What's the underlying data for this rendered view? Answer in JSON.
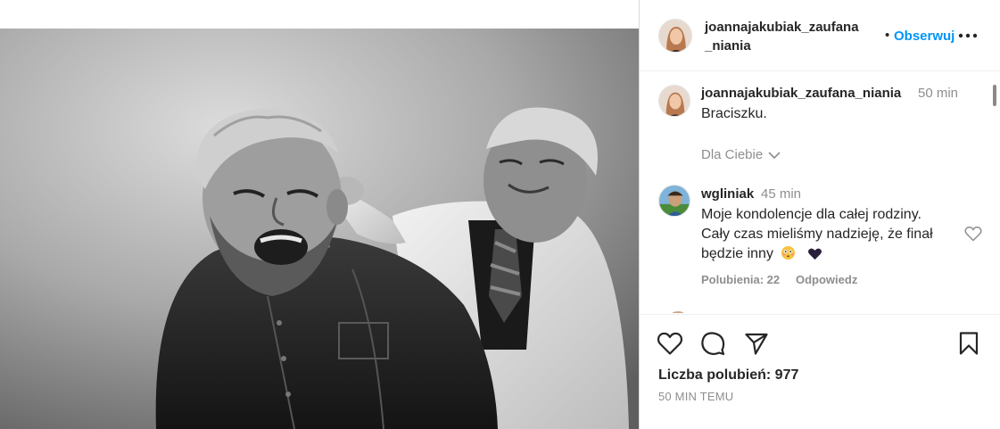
{
  "post": {
    "username": "joannajakubiak_zaufana_niania",
    "header_username_line1": "joannajakubiak_zaufana",
    "header_username_line2": "_niania",
    "follow_label": "Obserwuj",
    "dot_separator": "•",
    "caption": {
      "username": "joannajakubiak_zaufana_niania",
      "time": "50 min",
      "text": "Braciszku."
    },
    "for_you_label": "Dla Ciebie",
    "comments": [
      {
        "username": "wgliniak",
        "time": "45 min",
        "text_line1": "Moje kondolencje dla całej rodziny.",
        "text_line2": "Cały czas mieliśmy nadzieję, że finał",
        "text_line3": "będzie inny",
        "likes_label": "Polubienia: 22",
        "reply_label": "Odpowiedz"
      }
    ],
    "likes_text": "Liczba polubień: 977",
    "posted_ago": "50 MIN TEMU"
  },
  "icons": {
    "more": "more-horizontal-icon",
    "like": "heart-icon",
    "comment": "comment-icon",
    "share": "send-icon",
    "save": "bookmark-icon",
    "chevron": "chevron-down-icon",
    "emoji1": "flushed-face-emoji",
    "emoji2": "black-heart-emoji"
  },
  "colors": {
    "accent": "#0095f6",
    "text": "#262626",
    "secondary": "#8e8e8e",
    "border": "#dbdbdb"
  }
}
